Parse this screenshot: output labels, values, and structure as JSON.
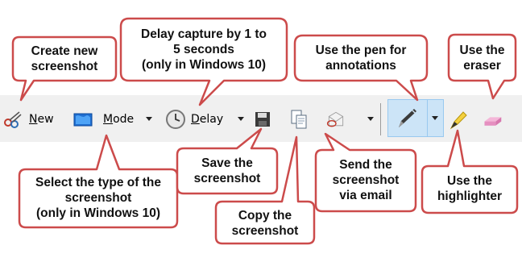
{
  "toolbar": {
    "new_label": "New",
    "mode_label": "Mode",
    "delay_label": "Delay"
  },
  "icons": {
    "new": "scissors-icon",
    "mode": "snip-mode-icon",
    "delay": "clock-icon",
    "save": "floppy-disk-icon",
    "copy": "copy-icon",
    "send": "envelope-icon",
    "pen": "pen-icon",
    "highlighter": "highlighter-icon",
    "eraser": "eraser-icon"
  },
  "callouts": {
    "create": [
      "Create new",
      "screenshot"
    ],
    "delay": [
      "Delay capture by 1 to",
      "5 seconds",
      "(only in Windows 10)"
    ],
    "pen": [
      "Use the pen for",
      "annotations"
    ],
    "eraser": [
      "Use the",
      "eraser"
    ],
    "mode": [
      "Select the type of the",
      "screenshot",
      "(only in Windows 10)"
    ],
    "save": [
      "Save the",
      "screenshot"
    ],
    "copy": [
      "Copy the",
      "screenshot"
    ],
    "send": [
      "Send the",
      "screenshot",
      "via email"
    ],
    "highlighter": [
      "Use the",
      "highlighter"
    ]
  },
  "colors": {
    "callout_fill": "#ffffff",
    "callout_stroke": "#cc4b4b",
    "toolbar_bg": "#f0f0f0",
    "pen_selected_bg": "#cce4f7"
  }
}
